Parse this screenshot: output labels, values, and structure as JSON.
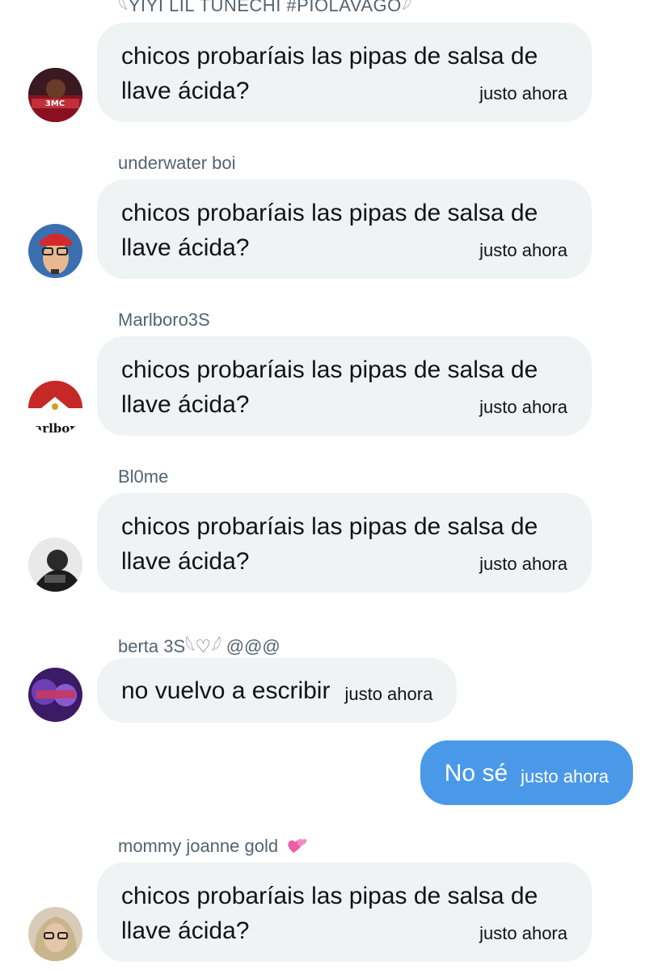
{
  "messages": [
    {
      "sender": "𓆩YIYI LIL TUNECHI #PIOLAVAGO𓆪",
      "text": "chicos probaríais las pipas de salsa de llave ácida?",
      "time": "justo ahora",
      "avatar_text": "3MC"
    },
    {
      "sender": "underwater boi",
      "text": "chicos probaríais las pipas de salsa de llave ácida?",
      "time": "justo ahora"
    },
    {
      "sender": "Marlboro3S",
      "text": "chicos probaríais las pipas de salsa de llave ácida?",
      "time": "justo ahora",
      "avatar_text": "Marlboro"
    },
    {
      "sender": "Bl0me",
      "text": "chicos probaríais las pipas de salsa de llave ácida?",
      "time": "justo ahora"
    },
    {
      "sender": "berta 3S𓆩♡𓆪 @@@",
      "text": "no vuelvo a escribir",
      "time": "justo ahora"
    },
    {
      "sender": "",
      "text": "No sé",
      "time": "justo ahora",
      "own": true
    },
    {
      "sender": "mommy joanne gold",
      "sender_emoji": "two-hearts",
      "text": "chicos probaríais las pipas de salsa de llave ácida?",
      "time": "justo ahora"
    }
  ],
  "colors": {
    "bubble_received": "#eff3f4",
    "bubble_sent": "#4a99e9",
    "sender_name": "#536471",
    "text": "#0f1419"
  }
}
